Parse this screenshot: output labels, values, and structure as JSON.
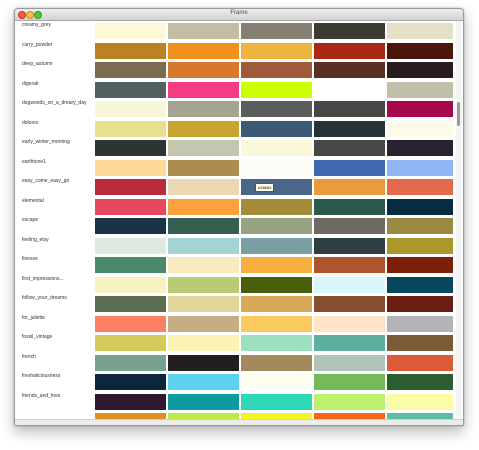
{
  "window": {
    "title": "Frame"
  },
  "tooltip": {
    "text": "#38683"
  },
  "palettes": [
    {
      "name": "creamy_grey",
      "colors": [
        "#fdf8d8",
        "#c3bda5",
        "#858072",
        "#3b3b33",
        "#e4e0c8"
      ]
    },
    {
      "name": "curry_powder",
      "colors": [
        "#b98222",
        "#f0911d",
        "#efb43f",
        "#a92914",
        "#4a160c"
      ]
    },
    {
      "name": "deep_autumn",
      "colors": [
        "#7b6b50",
        "#d6782d",
        "#a05a3a",
        "#5a2f24",
        "#2a1c1e"
      ]
    },
    {
      "name": "digerati",
      "colors": [
        "#536064",
        "#f33c83",
        "#ccff00",
        "#ffffff",
        "#c0c0aa"
      ]
    },
    {
      "name": "dogwoods_on_a_dreary_day",
      "colors": [
        "#f8f6d8",
        "#a5a493",
        "#595d5c",
        "#474747",
        "#a8064a"
      ]
    },
    {
      "name": "dolores",
      "colors": [
        "#e6e08f",
        "#c9a42e",
        "#3d5a74",
        "#273334",
        "#fdfbe7"
      ]
    },
    {
      "name": "early_winter_morning",
      "colors": [
        "#2c3534",
        "#c3c7b0",
        "#fbf8d9",
        "#474747",
        "#2a2230"
      ]
    },
    {
      "name": "earthtone1",
      "colors": [
        "#fdd999",
        "#ad8a4d",
        "#fdfcf8",
        "#3e69b1",
        "#92b5f5"
      ]
    },
    {
      "name": "easy_come_easy_go",
      "colors": [
        "#bb2b3a",
        "#ecd7b4",
        "#4a6789",
        "#e89c3e",
        "#e36a4a"
      ]
    },
    {
      "name": "elemental",
      "colors": [
        "#e7485f",
        "#fca13f",
        "#a48b3a",
        "#2d5b4b",
        "#072c3f"
      ]
    },
    {
      "name": "escape",
      "colors": [
        "#1a3346",
        "#365f52",
        "#97a484",
        "#6c6a62",
        "#9a8940"
      ]
    },
    {
      "name": "feeling_etsy",
      "colors": [
        "#dde9e1",
        "#a3d3d5",
        "#7a9ea3",
        "#2e3f44",
        "#aa982b"
      ]
    },
    {
      "name": "finesse",
      "colors": [
        "#488a6a",
        "#f8ecbe",
        "#f7b03e",
        "#b1532d",
        "#7f1f08"
      ]
    },
    {
      "name": "first_impressions...",
      "colors": [
        "#f7f1c2",
        "#b9cb72",
        "#485e0b",
        "#dcf7fb",
        "#07465d"
      ]
    },
    {
      "name": "follow_your_dreams",
      "colors": [
        "#5c6f53",
        "#ded69b",
        "#d7a958",
        "#875131",
        "#6b1c13"
      ]
    },
    {
      "name": "for_juliette",
      "colors": [
        "#fd8063",
        "#c7ad86",
        "#fbca5c",
        "#fde4c6",
        "#b4b3b8"
      ]
    },
    {
      "name": "fossil_vintage",
      "colors": [
        "#d6ca5b",
        "#fbf2b5",
        "#9de0c0",
        "#5db19c",
        "#7b5b36"
      ]
    },
    {
      "name": "french",
      "colors": [
        "#78a190",
        "#241f1f",
        "#a3895c",
        "#b1c2b8",
        "#da5a3a"
      ]
    },
    {
      "name": "freshaliciousness",
      "colors": [
        "#0d263b",
        "#5dd1ef",
        "#fcfef0",
        "#74b95a",
        "#2c5d30"
      ]
    },
    {
      "name": "friends_and_foes",
      "colors": [
        "#2d1a30",
        "#0f9a9d",
        "#2ed9b8",
        "#bdf06d",
        "#fbfda6"
      ]
    },
    {
      "name": "",
      "colors": [
        "#e18f1f",
        "#bfe940",
        "#f6f31e",
        "#f6641a",
        "#5cbca4"
      ]
    }
  ]
}
